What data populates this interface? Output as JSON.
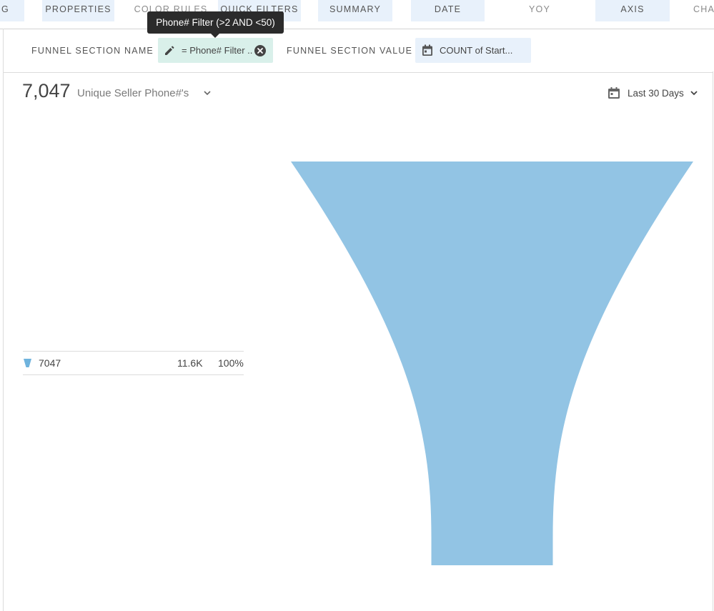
{
  "tabs": [
    {
      "label": "G",
      "style": "filled"
    },
    {
      "label": "PROPERTIES",
      "style": "filled"
    },
    {
      "label": "COLOR RULES",
      "style": "plain"
    },
    {
      "label": "QUICK FILTERS",
      "style": "filled"
    },
    {
      "label": "SUMMARY",
      "style": "filled"
    },
    {
      "label": "DATE",
      "style": "filled"
    },
    {
      "label": "YOY",
      "style": "plain"
    },
    {
      "label": "AXIS",
      "style": "filled"
    },
    {
      "label": "CHA",
      "style": "plain"
    }
  ],
  "tooltip": {
    "text": "Phone# Filter (>2 AND <50)"
  },
  "filter_bar": {
    "section_name_label": "FUNNEL SECTION NAME",
    "section_name_pill": "= Phone# Filter ...",
    "section_name_pill_icon": "pencil-icon",
    "section_name_clear_icon": "clear-circle-icon",
    "section_value_label": "FUNNEL SECTION VALUE",
    "section_value_pill": "COUNT of Start...",
    "section_value_pill_icon": "calendar-icon"
  },
  "summary": {
    "big_number": "7,047",
    "metric_label": "Unique Seller Phone#'s",
    "date_range": "Last 30 Days"
  },
  "legend": [
    {
      "name": "7047",
      "value": "11.6K",
      "percent": "100%"
    }
  ],
  "colors": {
    "funnel_fill": "#92c4e4",
    "legend_icon": "#6fb3dd",
    "pill_green": "#d9f0ea",
    "pill_blue": "#e8f1fb"
  },
  "chart_data": {
    "type": "funnel",
    "categories": [
      "7047"
    ],
    "values": [
      11600
    ],
    "percent": [
      100
    ]
  }
}
